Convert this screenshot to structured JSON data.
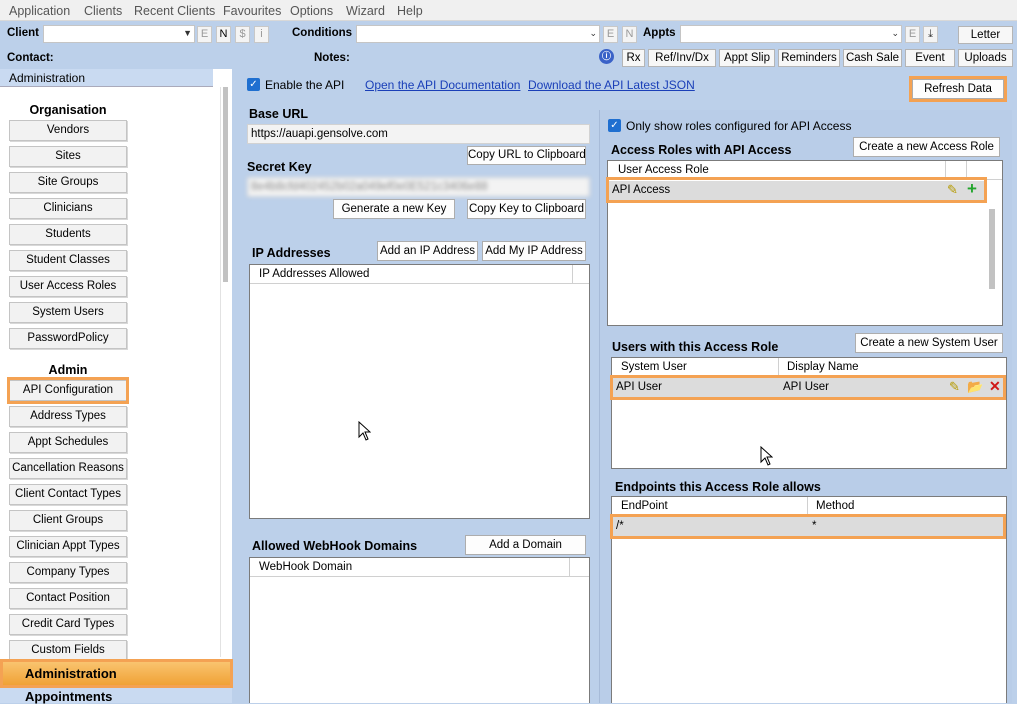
{
  "menu": [
    "Application",
    "Clients",
    "Recent Clients",
    "Favourites",
    "Options",
    "Wizard",
    "Help"
  ],
  "toolbar": {
    "client_label": "Client",
    "conditions_label": "Conditions",
    "appts_label": "Appts",
    "contact_label": "Contact:",
    "notes_label": "Notes:",
    "client_small_buttons": [
      "E",
      "N",
      "$",
      "i"
    ],
    "conditions_small_buttons": [
      "E",
      "N"
    ],
    "appts_small_button": "E",
    "letter_button": "Letter",
    "action_buttons": [
      "Rx",
      "Ref/Inv/Dx",
      "Appt Slip",
      "Reminders",
      "Cash Sale",
      "Event",
      "Uploads"
    ]
  },
  "left": {
    "header": "Administration",
    "sections": {
      "organisation": "Organisation",
      "admin": "Admin"
    },
    "org_items": [
      "Vendors",
      "Sites",
      "Site Groups",
      "Clinicians",
      "Students",
      "Student Classes",
      "User Access Roles",
      "System Users",
      "PasswordPolicy"
    ],
    "admin_items": [
      "API Configuration",
      "Address Types",
      "Appt Schedules",
      "Cancellation Reasons",
      "Client Contact Types",
      "Client Groups",
      "Clinician Appt Types",
      "Company Types",
      "Contact Position",
      "Credit Card Types",
      "Custom Fields"
    ],
    "nav_active": "Administration",
    "nav_next": "Appointments"
  },
  "main": {
    "enable_api": "Enable the API",
    "open_docs": "Open the API Documentation",
    "download_json": "Download the API Latest JSON",
    "refresh": "Refresh Data",
    "base_url_label": "Base URL",
    "base_url": "https://auapi.gensolve.com",
    "copy_url": "Copy URL to Clipboard",
    "secret_key_label": "Secret Key",
    "secret_key_masked": "8e4b8cfd402452b02a049ef0e0E521c3406e88",
    "gen_key": "Generate a new Key",
    "copy_key": "Copy Key to Clipboard",
    "ip_label": "IP Addresses",
    "add_ip": "Add an IP Address",
    "add_my_ip": "Add My IP Address",
    "ip_col": "IP Addresses Allowed",
    "webhook_label": "Allowed WebHook Domains",
    "add_domain": "Add a Domain",
    "webhook_col": "WebHook Domain",
    "only_roles": "Only show roles configured for API Access",
    "roles_label": "Access Roles with API Access",
    "new_role": "Create a new Access Role",
    "roles_col": "User Access Role",
    "roles_rows": [
      "API Access"
    ],
    "users_label": "Users with this Access Role",
    "new_user": "Create a new System User",
    "users_cols": [
      "System User",
      "Display Name"
    ],
    "users_rows": [
      {
        "user": "API User",
        "display": "API User"
      }
    ],
    "endpoints_label": "Endpoints this Access Role allows",
    "endpoints_cols": [
      "EndPoint",
      "Method"
    ],
    "endpoints_rows": [
      {
        "endpoint": "/*",
        "method": "*"
      }
    ]
  }
}
